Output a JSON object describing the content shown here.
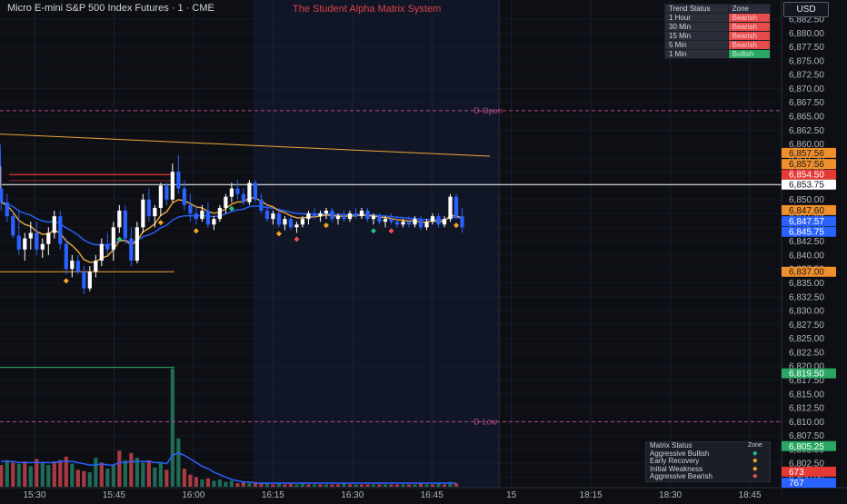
{
  "header": {
    "symbol_title": "Micro E-mini S&P 500 Index Futures · 1 · CME",
    "system_title": "The Student Alpha Matrix System",
    "currency": "USD"
  },
  "trend_table": {
    "headers": [
      "Trend Status",
      "Zone"
    ],
    "rows": [
      {
        "tf": "1 Hour",
        "zone": "Bearish",
        "state": "bear"
      },
      {
        "tf": "30 Min",
        "zone": "Bearish",
        "state": "bear"
      },
      {
        "tf": "15 Min",
        "zone": "Bearish",
        "state": "bear"
      },
      {
        "tf": "5 Min",
        "zone": "Bearish",
        "state": "bear"
      },
      {
        "tf": "1 Min",
        "zone": "Bullish",
        "state": "bull"
      }
    ]
  },
  "matrix_table": {
    "headers": [
      "Matrix Status",
      "Zone"
    ],
    "rows": [
      {
        "label": "Aggressive Bullish",
        "symbol": "◆",
        "color": "#26c281"
      },
      {
        "label": "Early Recovery",
        "symbol": "◆",
        "color": "#f5a623"
      },
      {
        "label": "Initial Weakness",
        "symbol": "◆",
        "color": "#f5a623"
      },
      {
        "label": "Aggressive Bearish",
        "symbol": "◆",
        "color": "#ef4f4f"
      }
    ]
  },
  "chart_data": {
    "type": "candlestick",
    "instrument": "Micro E-mini S&P 500 Index Futures",
    "interval": "1",
    "exchange": "CME",
    "ylim": [
      6800.0,
      6885.0
    ],
    "price_ticks": [
      "6,882.50",
      "6,880.00",
      "6,877.50",
      "6,875.00",
      "6,872.50",
      "6,870.00",
      "6,867.50",
      "6,865.00",
      "6,862.50",
      "6,860.00",
      "6,857.50",
      "6,855.00",
      "6,852.50",
      "6,850.00",
      "6,847.50",
      "6,845.00",
      "6,842.50",
      "6,840.00",
      "6,837.50",
      "6,835.00",
      "6,832.50",
      "6,830.00",
      "6,827.50",
      "6,825.00",
      "6,822.50",
      "6,820.00",
      "6,817.50",
      "6,815.00",
      "6,812.50",
      "6,810.00",
      "6,807.50",
      "6,805.00",
      "6,802.50",
      "6,800.00"
    ],
    "time_ticks": [
      "15:30",
      "15:45",
      "16:00",
      "16:15",
      "16:30",
      "16:45",
      "15",
      "18:15",
      "18:30",
      "18:45"
    ],
    "time_positions_min": [
      0,
      15,
      30,
      45,
      60,
      75,
      90,
      105,
      120,
      135
    ],
    "session_start_min": 45,
    "last_bar_min": 87,
    "levels": [
      {
        "label": "D-Open",
        "price": 6866.0,
        "color": "#b04b8a",
        "style": "dashed"
      },
      {
        "label": "D-Low",
        "price": 6810.0,
        "color": "#b04b8a",
        "style": "dashed"
      }
    ],
    "price_badges": [
      {
        "text": "6,857.56",
        "price": 6858.4,
        "bg": "#f0902c",
        "fg": "#1a1a1a"
      },
      {
        "text": "6,857.56",
        "price": 6856.4,
        "bg": "#f0902c",
        "fg": "#1a1a1a"
      },
      {
        "text": "6,854.50",
        "price": 6854.5,
        "bg": "#e53935",
        "fg": "#ffffff"
      },
      {
        "text": "6,853.75",
        "price": 6852.7,
        "bg": "#ffffff",
        "fg": "#131722"
      },
      {
        "text": "6,847.60",
        "price": 6848.1,
        "bg": "#f0902c",
        "fg": "#1a1a1a"
      },
      {
        "text": "6,847.57",
        "price": 6846.1,
        "bg": "#2962ff",
        "fg": "#ffffff"
      },
      {
        "text": "6,845.75",
        "price": 6844.2,
        "bg": "#2962ff",
        "fg": "#ffffff"
      },
      {
        "text": "6,837.00",
        "price": 6837.0,
        "bg": "#f0902c",
        "fg": "#1a1a1a"
      },
      {
        "text": "6,819.50",
        "price": 6818.7,
        "bg": "#2aa763",
        "fg": "#ffffff"
      },
      {
        "text": "6,805.25",
        "price": 6805.6,
        "bg": "#2aa763",
        "fg": "#ffffff"
      },
      {
        "text": "673",
        "price": 6801.0,
        "bg": "#e53935",
        "fg": "#ffffff"
      },
      {
        "text": "767",
        "price": 6799.0,
        "bg": "#2962ff",
        "fg": "#ffffff"
      }
    ],
    "candles": [
      {
        "o": 6852.0,
        "h": 6856.0,
        "l": 6848.0,
        "c": 6849.5
      },
      {
        "o": 6849.5,
        "h": 6851.0,
        "l": 6846.0,
        "c": 6847.0
      },
      {
        "o": 6847.0,
        "h": 6848.0,
        "l": 6843.0,
        "c": 6843.5
      },
      {
        "o": 6843.5,
        "h": 6848.0,
        "l": 6840.0,
        "c": 6841.0
      },
      {
        "o": 6841.0,
        "h": 6844.0,
        "l": 6839.0,
        "c": 6843.0
      },
      {
        "o": 6843.0,
        "h": 6846.0,
        "l": 6841.0,
        "c": 6844.0
      },
      {
        "o": 6844.0,
        "h": 6846.0,
        "l": 6840.0,
        "c": 6841.0
      },
      {
        "o": 6841.0,
        "h": 6843.0,
        "l": 6839.5,
        "c": 6842.0
      },
      {
        "o": 6842.0,
        "h": 6845.0,
        "l": 6840.0,
        "c": 6844.0
      },
      {
        "o": 6844.0,
        "h": 6848.0,
        "l": 6843.0,
        "c": 6847.0
      },
      {
        "o": 6847.0,
        "h": 6848.0,
        "l": 6841.0,
        "c": 6842.0
      },
      {
        "o": 6842.0,
        "h": 6843.0,
        "l": 6836.5,
        "c": 6837.5
      },
      {
        "o": 6837.5,
        "h": 6840.0,
        "l": 6836.0,
        "c": 6839.0
      },
      {
        "o": 6839.0,
        "h": 6840.0,
        "l": 6836.5,
        "c": 6837.0
      },
      {
        "o": 6837.0,
        "h": 6838.0,
        "l": 6833.0,
        "c": 6834.0
      },
      {
        "o": 6834.0,
        "h": 6838.0,
        "l": 6833.5,
        "c": 6837.0
      },
      {
        "o": 6837.0,
        "h": 6840.0,
        "l": 6836.0,
        "c": 6839.0
      },
      {
        "o": 6839.0,
        "h": 6843.0,
        "l": 6838.0,
        "c": 6842.0
      },
      {
        "o": 6842.0,
        "h": 6844.0,
        "l": 6840.0,
        "c": 6841.0
      },
      {
        "o": 6841.0,
        "h": 6846.0,
        "l": 6839.0,
        "c": 6845.0
      },
      {
        "o": 6845.0,
        "h": 6849.0,
        "l": 6844.0,
        "c": 6848.0
      },
      {
        "o": 6848.0,
        "h": 6849.0,
        "l": 6842.0,
        "c": 6843.0
      },
      {
        "o": 6843.0,
        "h": 6845.0,
        "l": 6838.0,
        "c": 6839.0
      },
      {
        "o": 6839.0,
        "h": 6846.0,
        "l": 6838.5,
        "c": 6845.0
      },
      {
        "o": 6845.0,
        "h": 6851.0,
        "l": 6844.0,
        "c": 6850.0
      },
      {
        "o": 6850.0,
        "h": 6852.0,
        "l": 6846.0,
        "c": 6847.0
      },
      {
        "o": 6847.0,
        "h": 6849.0,
        "l": 6845.0,
        "c": 6848.5
      },
      {
        "o": 6848.5,
        "h": 6853.0,
        "l": 6847.0,
        "c": 6852.5
      },
      {
        "o": 6852.5,
        "h": 6853.0,
        "l": 6849.0,
        "c": 6850.0
      },
      {
        "o": 6850.0,
        "h": 6856.5,
        "l": 6849.5,
        "c": 6855.0
      },
      {
        "o": 6855.0,
        "h": 6858.0,
        "l": 6851.0,
        "c": 6852.0
      },
      {
        "o": 6852.0,
        "h": 6853.5,
        "l": 6848.0,
        "c": 6849.0
      },
      {
        "o": 6849.0,
        "h": 6851.0,
        "l": 6846.0,
        "c": 6847.5
      },
      {
        "o": 6847.5,
        "h": 6849.0,
        "l": 6845.5,
        "c": 6846.5
      },
      {
        "o": 6846.5,
        "h": 6849.0,
        "l": 6846.0,
        "c": 6848.0
      },
      {
        "o": 6848.0,
        "h": 6849.5,
        "l": 6845.0,
        "c": 6845.5
      },
      {
        "o": 6845.5,
        "h": 6847.0,
        "l": 6844.5,
        "c": 6846.5
      },
      {
        "o": 6846.5,
        "h": 6849.0,
        "l": 6846.0,
        "c": 6848.5
      },
      {
        "o": 6848.5,
        "h": 6851.0,
        "l": 6847.5,
        "c": 6850.5
      },
      {
        "o": 6850.5,
        "h": 6853.0,
        "l": 6849.5,
        "c": 6852.0
      },
      {
        "o": 6852.0,
        "h": 6853.5,
        "l": 6850.0,
        "c": 6851.0
      },
      {
        "o": 6851.0,
        "h": 6852.0,
        "l": 6849.0,
        "c": 6849.5
      },
      {
        "o": 6849.5,
        "h": 6853.5,
        "l": 6849.0,
        "c": 6853.0
      },
      {
        "o": 6853.0,
        "h": 6853.5,
        "l": 6849.5,
        "c": 6850.0
      },
      {
        "o": 6850.0,
        "h": 6851.0,
        "l": 6847.5,
        "c": 6848.0
      },
      {
        "o": 6848.0,
        "h": 6849.0,
        "l": 6846.0,
        "c": 6846.5
      },
      {
        "o": 6846.5,
        "h": 6848.0,
        "l": 6845.5,
        "c": 6847.5
      },
      {
        "o": 6847.5,
        "h": 6848.5,
        "l": 6845.0,
        "c": 6845.5
      },
      {
        "o": 6845.5,
        "h": 6847.0,
        "l": 6844.5,
        "c": 6846.5
      },
      {
        "o": 6846.5,
        "h": 6847.0,
        "l": 6844.5,
        "c": 6845.0
      },
      {
        "o": 6845.0,
        "h": 6846.0,
        "l": 6844.0,
        "c": 6845.5
      },
      {
        "o": 6845.5,
        "h": 6847.0,
        "l": 6845.0,
        "c": 6846.5
      },
      {
        "o": 6846.5,
        "h": 6848.0,
        "l": 6845.5,
        "c": 6847.5
      },
      {
        "o": 6847.5,
        "h": 6848.5,
        "l": 6846.5,
        "c": 6847.0
      },
      {
        "o": 6847.0,
        "h": 6848.0,
        "l": 6846.0,
        "c": 6847.5
      },
      {
        "o": 6847.5,
        "h": 6848.5,
        "l": 6846.5,
        "c": 6848.0
      },
      {
        "o": 6848.0,
        "h": 6848.5,
        "l": 6846.0,
        "c": 6846.5
      },
      {
        "o": 6846.5,
        "h": 6847.5,
        "l": 6845.5,
        "c": 6847.0
      },
      {
        "o": 6847.0,
        "h": 6848.0,
        "l": 6846.0,
        "c": 6846.5
      },
      {
        "o": 6846.5,
        "h": 6848.0,
        "l": 6846.0,
        "c": 6847.5
      },
      {
        "o": 6847.5,
        "h": 6848.5,
        "l": 6846.5,
        "c": 6847.0
      },
      {
        "o": 6847.0,
        "h": 6848.5,
        "l": 6846.5,
        "c": 6848.0
      },
      {
        "o": 6848.0,
        "h": 6848.5,
        "l": 6846.0,
        "c": 6846.5
      },
      {
        "o": 6846.5,
        "h": 6847.5,
        "l": 6845.5,
        "c": 6847.0
      },
      {
        "o": 6847.0,
        "h": 6847.5,
        "l": 6845.5,
        "c": 6846.0
      },
      {
        "o": 6846.0,
        "h": 6847.0,
        "l": 6845.0,
        "c": 6846.5
      },
      {
        "o": 6846.5,
        "h": 6847.5,
        "l": 6845.5,
        "c": 6846.0
      },
      {
        "o": 6846.0,
        "h": 6847.0,
        "l": 6845.0,
        "c": 6845.5
      },
      {
        "o": 6845.5,
        "h": 6846.5,
        "l": 6845.0,
        "c": 6846.0
      },
      {
        "o": 6846.0,
        "h": 6847.0,
        "l": 6845.0,
        "c": 6845.5
      },
      {
        "o": 6845.5,
        "h": 6847.0,
        "l": 6845.0,
        "c": 6846.5
      },
      {
        "o": 6846.5,
        "h": 6847.0,
        "l": 6844.5,
        "c": 6845.0
      },
      {
        "o": 6845.0,
        "h": 6846.5,
        "l": 6844.5,
        "c": 6846.0
      },
      {
        "o": 6846.0,
        "h": 6847.5,
        "l": 6845.5,
        "c": 6847.0
      },
      {
        "o": 6847.0,
        "h": 6847.5,
        "l": 6845.0,
        "c": 6845.5
      },
      {
        "o": 6845.5,
        "h": 6847.0,
        "l": 6845.0,
        "c": 6846.5
      },
      {
        "o": 6846.5,
        "h": 6851.0,
        "l": 6846.0,
        "c": 6850.5
      },
      {
        "o": 6850.5,
        "h": 6851.0,
        "l": 6846.5,
        "c": 6847.0
      },
      {
        "o": 6847.0,
        "h": 6848.5,
        "l": 6844.0,
        "c": 6845.0
      }
    ],
    "volume_ylim": [
      0,
      100
    ],
    "volume": [
      [
        18,
        "d"
      ],
      [
        22,
        "u"
      ],
      [
        20,
        "d"
      ],
      [
        19,
        "u"
      ],
      [
        21,
        "d"
      ],
      [
        17,
        "u"
      ],
      [
        23,
        "d"
      ],
      [
        20,
        "u"
      ],
      [
        18,
        "u"
      ],
      [
        21,
        "d"
      ],
      [
        22,
        "d"
      ],
      [
        25,
        "d"
      ],
      [
        19,
        "u"
      ],
      [
        14,
        "d"
      ],
      [
        13,
        "d"
      ],
      [
        12,
        "u"
      ],
      [
        24,
        "u"
      ],
      [
        20,
        "d"
      ],
      [
        15,
        "u"
      ],
      [
        18,
        "u"
      ],
      [
        30,
        "d"
      ],
      [
        22,
        "u"
      ],
      [
        28,
        "d"
      ],
      [
        24,
        "u"
      ],
      [
        20,
        "u"
      ],
      [
        22,
        "d"
      ],
      [
        16,
        "u"
      ],
      [
        20,
        "u"
      ],
      [
        14,
        "d"
      ],
      [
        98,
        "u"
      ],
      [
        40,
        "u"
      ],
      [
        15,
        "d"
      ],
      [
        10,
        "d"
      ],
      [
        8,
        "d"
      ],
      [
        6,
        "u"
      ],
      [
        7,
        "d"
      ],
      [
        5,
        "u"
      ],
      [
        6,
        "u"
      ],
      [
        4,
        "u"
      ],
      [
        5,
        "u"
      ],
      [
        3,
        "d"
      ],
      [
        4,
        "d"
      ],
      [
        3,
        "u"
      ],
      [
        4,
        "d"
      ],
      [
        3,
        "d"
      ],
      [
        3,
        "u"
      ],
      [
        2,
        "d"
      ],
      [
        3,
        "u"
      ],
      [
        2,
        "d"
      ],
      [
        3,
        "d"
      ],
      [
        2,
        "u"
      ],
      [
        3,
        "u"
      ],
      [
        2,
        "d"
      ],
      [
        2,
        "u"
      ],
      [
        2,
        "d"
      ],
      [
        2,
        "u"
      ],
      [
        2,
        "d"
      ],
      [
        2,
        "d"
      ],
      [
        3,
        "u"
      ],
      [
        2,
        "d"
      ],
      [
        2,
        "u"
      ],
      [
        2,
        "d"
      ],
      [
        2,
        "d"
      ],
      [
        2,
        "u"
      ],
      [
        2,
        "d"
      ],
      [
        2,
        "u"
      ],
      [
        2,
        "d"
      ],
      [
        2,
        "d"
      ],
      [
        2,
        "u"
      ],
      [
        2,
        "d"
      ],
      [
        2,
        "u"
      ],
      [
        3,
        "d"
      ],
      [
        2,
        "u"
      ],
      [
        2,
        "d"
      ],
      [
        3,
        "u"
      ],
      [
        2,
        "d"
      ],
      [
        4,
        "u"
      ],
      [
        3,
        "d"
      ]
    ],
    "volume_avg": [
      21,
      21,
      21,
      20,
      20,
      20,
      20,
      20,
      20,
      20,
      21,
      21,
      21,
      20,
      19,
      18,
      18,
      19,
      18,
      18,
      20,
      20,
      21,
      21,
      21,
      21,
      20,
      20,
      19,
      26,
      28,
      26,
      23,
      20,
      17,
      15,
      12,
      10,
      8,
      6,
      5,
      4,
      4,
      3,
      3,
      3,
      3,
      3,
      3,
      3,
      3,
      3,
      3,
      3,
      3,
      3,
      3,
      3,
      3,
      3,
      3,
      3,
      3,
      3,
      3,
      3,
      3,
      3,
      3,
      3,
      3,
      3,
      3,
      3,
      3,
      3,
      3,
      3
    ],
    "signals": [
      {
        "bar": 11,
        "type": "early_recovery",
        "pos": "below"
      },
      {
        "bar": 20,
        "type": "aggressive_bullish",
        "pos": "below"
      },
      {
        "bar": 27,
        "type": "early_recovery",
        "pos": "below"
      },
      {
        "bar": 33,
        "type": "early_recovery",
        "pos": "below"
      },
      {
        "bar": 39,
        "type": "aggressive_bullish",
        "pos": "below"
      },
      {
        "bar": 47,
        "type": "early_recovery",
        "pos": "below"
      },
      {
        "bar": 50,
        "type": "aggressive_bearish",
        "pos": "below"
      },
      {
        "bar": 55,
        "type": "early_recovery",
        "pos": "below"
      },
      {
        "bar": 63,
        "type": "aggressive_bullish",
        "pos": "below"
      },
      {
        "bar": 66,
        "type": "aggressive_bearish",
        "pos": "below"
      },
      {
        "bar": 77,
        "type": "early_recovery",
        "pos": "below"
      }
    ],
    "signal_colors": {
      "aggressive_bullish": "#26c281",
      "early_recovery": "#f5a623",
      "initial_weakness": "#f5a623",
      "aggressive_bearish": "#ef4f4f"
    },
    "colors": {
      "up": "#ffffff",
      "down": "#2962ff",
      "vol_up": "#1f6b57",
      "vol_down": "#a83a42",
      "ema_fast": "#f0a83a",
      "ema_slow": "#2962ff",
      "grid": "#1c2030",
      "session_bg": "#111626"
    }
  }
}
